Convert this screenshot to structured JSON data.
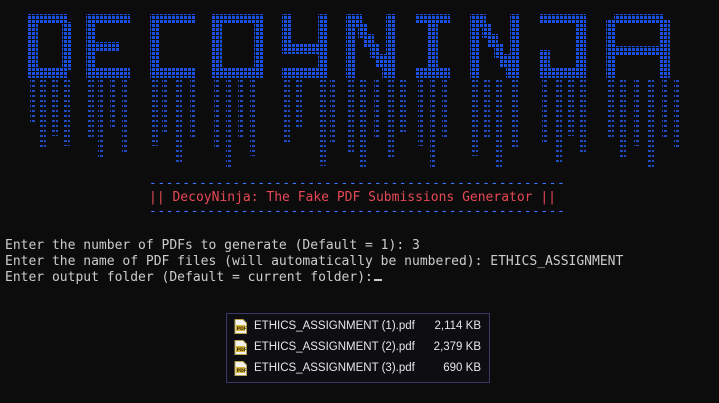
{
  "banner": {
    "rule": "--------------------------------------------------",
    "title": "|| DecoyNinja: The Fake PDF Submissions Generator ||",
    "colors": {
      "logo": "#1a4fe0",
      "rain": "#1e4bbd",
      "rule": "#3b78ff",
      "title": "#e74856"
    }
  },
  "terminal": {
    "line1": "Enter the number of PDFs to generate (Default = 1): 3",
    "line2": "Enter the name of PDF files (will automatically be numbered): ETHICS_ASSIGNMENT",
    "line3": "Enter output folder (Default = current folder):"
  },
  "files": [
    {
      "name": "ETHICS_ASSIGNMENT (1).pdf",
      "size": "2,114 KB",
      "icon": "pdf-file-icon"
    },
    {
      "name": "ETHICS_ASSIGNMENT (2).pdf",
      "size": "2,379 KB",
      "icon": "pdf-file-icon"
    },
    {
      "name": "ETHICS_ASSIGNMENT (3).pdf",
      "size": "690 KB",
      "icon": "pdf-file-icon"
    }
  ]
}
